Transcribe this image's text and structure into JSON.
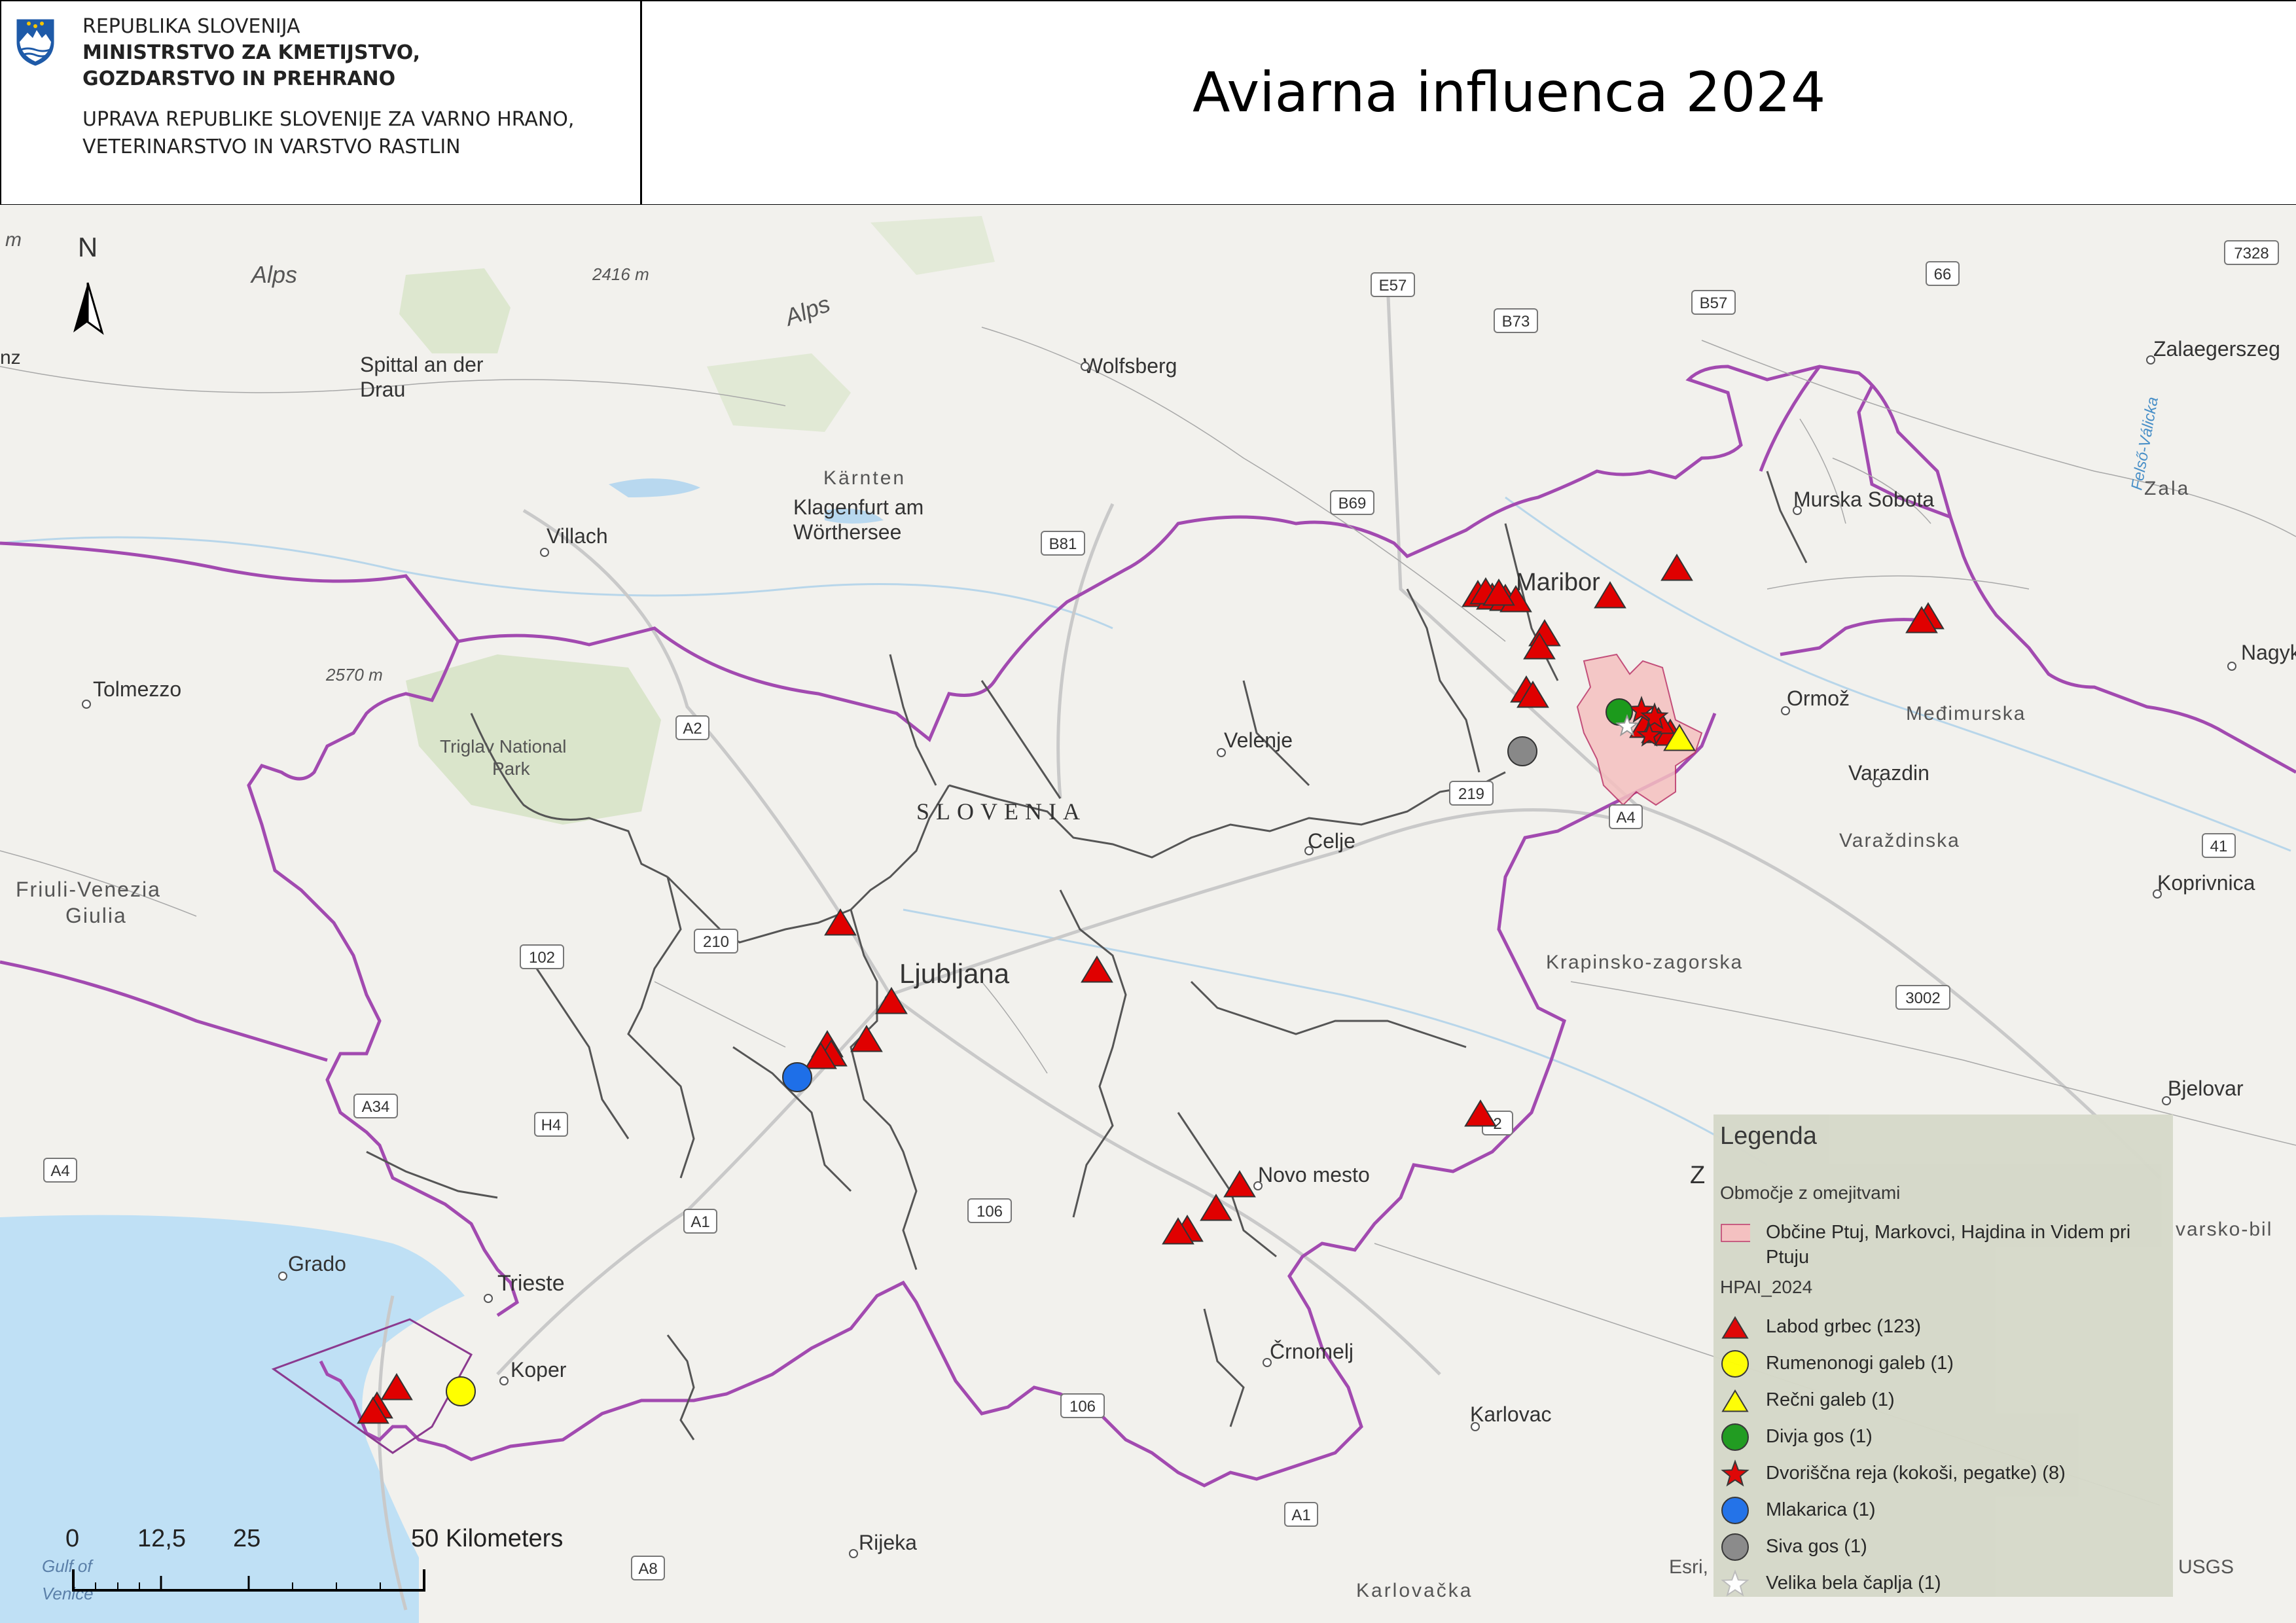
{
  "header": {
    "line1": "REPUBLIKA SLOVENIJA",
    "line2": "MINISTRSTVO ZA KMETIJSTVO,",
    "line3": "GOZDARSTVO IN PREHRANO",
    "line4": "UPRAVA REPUBLIKE SLOVENIJE ZA VARNO HRANO,",
    "line5": "VETERINARSTVO IN VARSTVO RASTLIN",
    "title": "Aviarna influenca 2024"
  },
  "map_labels": {
    "north": "N",
    "alps1": "Alps",
    "alps2": "Alps",
    "peak1": "2416 m",
    "peak2": "2570 m",
    "spittal": "Spittal an der",
    "drau": "Drau",
    "wolfsberg": "Wolfsberg",
    "karnten": "Kärnten",
    "klagenfurt1": "Klagenfurt am",
    "klagenfurt2": "Wörthersee",
    "villach": "Villach",
    "tolmezzo": "Tolmezzo",
    "triglav1": "Triglav National",
    "triglav2": "Park",
    "friuli1": "Friuli-Venezia",
    "friuli2": "Giulia",
    "slovenia": "SLOVENIA",
    "ljubljana": "Ljubljana",
    "velenje": "Velenje",
    "celje": "Celje",
    "maribor": "Maribor",
    "murska": "Murska Sobota",
    "ormoz": "Ormož",
    "medimurska": "Međimurska",
    "varazdin": "Varazdin",
    "varazdinska": "Varaždinska",
    "koprivnica": "Koprivnica",
    "krapinsko": "Krapinsko-zagorska",
    "bjelovar": "Bjelovar",
    "zalaegerszeg": "Zalaegerszeg",
    "zala": "Zala",
    "felso": "Felső-Válicka",
    "nagy": "Nagyk",
    "novo_mesto": "Novo mesto",
    "crnomelj": "Črnomelj",
    "karlovac": "Karlovac",
    "karlovacka": "Karlovačka",
    "rijeka": "Rijeka",
    "trieste": "Trieste",
    "koper": "Koper",
    "grado": "Grado",
    "gulf1": "Gulf of",
    "gulf2": "Venice",
    "m_edge": "m",
    "nz_edge": "nz",
    "z_edge": "Z",
    "bilo_edge": "varsko-bil"
  },
  "road_shields": [
    "E57",
    "B73",
    "B57",
    "66",
    "7328",
    "B69",
    "B81",
    "A2",
    "219",
    "A4",
    "41",
    "210",
    "102",
    "3002",
    "A34",
    "H4",
    "A4",
    "A1",
    "106",
    "106",
    "A1",
    "A8",
    "2"
  ],
  "legend": {
    "title": "Legenda",
    "restricted_header": "Območje z omejitvami",
    "restricted_label_1": "Občine Ptuj, Markovci, Hajdina in Videm pri",
    "restricted_label_2": "Ptuju",
    "hpai_header": "HPAI_2024",
    "items": [
      {
        "label": "Labod grbec (123)",
        "symbol": "triangle",
        "color": "#e00000"
      },
      {
        "label": "Rumenonogi galeb (1)",
        "symbol": "circle",
        "color": "#ffff00"
      },
      {
        "label": "Rečni galeb (1)",
        "symbol": "triangle",
        "color": "#ffff00"
      },
      {
        "label": "Divja gos (1)",
        "symbol": "circle",
        "color": "#1c9a1c"
      },
      {
        "label": "Dvoriščna reja (kokoši, pegatke) (8)",
        "symbol": "star",
        "color": "#e00000"
      },
      {
        "label": "Mlakarica (1)",
        "symbol": "circle",
        "color": "#1e6fe8"
      },
      {
        "label": "Siva gos (1)",
        "symbol": "circle",
        "color": "#888888"
      },
      {
        "label": "Velika bela čaplja (1)",
        "symbol": "star",
        "color": "#ffffff"
      }
    ],
    "restricted_color": "#f5c0c0"
  },
  "scale": {
    "t0": "0",
    "t1": "12,5",
    "t2": "25",
    "t3": "50 Kilometers"
  },
  "credits": {
    "left": "Esri,",
    "right": "USGS"
  }
}
